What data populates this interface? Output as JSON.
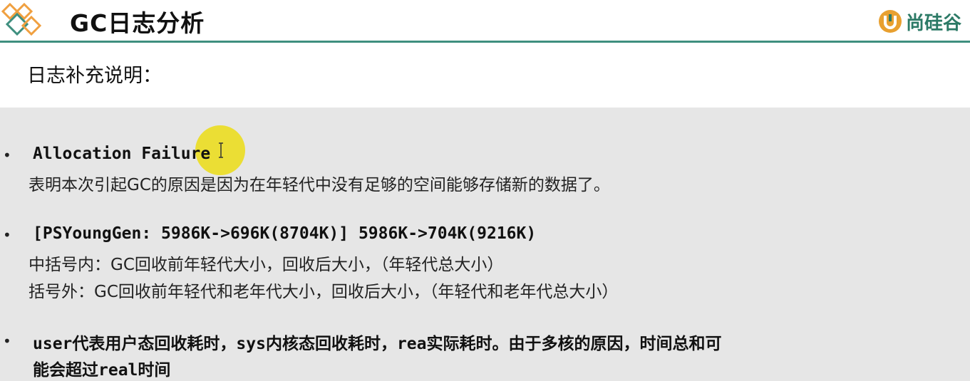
{
  "header": {
    "title": "GC日志分析",
    "logo_text": "尚硅谷",
    "accent_color": "#3f8f7f",
    "logo_color": "#2c7a66"
  },
  "subtitle": "日志补充说明：",
  "items": [
    {
      "bullet": "•",
      "heading": "Allocation Failure",
      "desc": "表明本次引起GC的原因是因为在年轻代中没有足够的空间能够存储新的数据了。"
    },
    {
      "bullet": "•",
      "heading": "[PSYoungGen: 5986K->696K(8704K)] 5986K->704K(9216K)",
      "desc_lines": [
        "中括号内：GC回收前年轻代大小，回收后大小，（年轻代总大小）",
        "括号外：GC回收前年轻代和老年代大小，回收后大小，（年轻代和老年代总大小）"
      ]
    },
    {
      "bullet": "•",
      "parts": [
        {
          "text": "user",
          "mono": true
        },
        {
          "text": "代表用户态回收耗时，",
          "mono": false
        },
        {
          "text": "sys",
          "mono": true
        },
        {
          "text": "内核态回收耗时，",
          "mono": false
        },
        {
          "text": "rea",
          "mono": true
        },
        {
          "text": "实际耗时。由于多核的原因，时间总和可",
          "mono": false
        }
      ],
      "parts_line2": [
        {
          "text": "能会超过",
          "mono": false
        },
        {
          "text": "real",
          "mono": true
        },
        {
          "text": "时间",
          "mono": false
        }
      ]
    }
  ],
  "icons": {
    "header_decoration": "diamonds-icon",
    "logo": "u-logo-icon",
    "cursor": "text-cursor-icon"
  },
  "colors": {
    "panel_bg": "#e6e6e6",
    "cursor_highlight": "#ebdc14",
    "diamond_orange": "#f0a040",
    "diamond_teal": "#3f8f7f"
  }
}
